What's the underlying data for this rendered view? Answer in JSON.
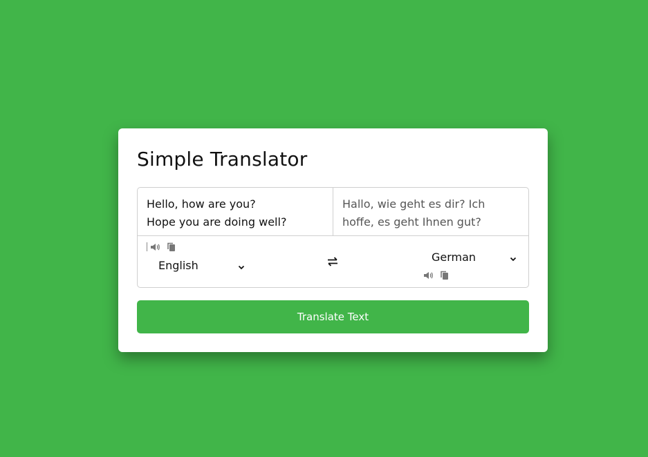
{
  "app": {
    "title": "Simple Translator"
  },
  "source": {
    "text": "Hello, how are you?\nHope you are doing well?",
    "language": "English"
  },
  "target": {
    "text": "Hallo, wie geht es dir? Ich hoffe, es geht Ihnen gut?",
    "language": "German"
  },
  "actions": {
    "translate_label": "Translate Text"
  },
  "colors": {
    "background": "#41b549",
    "button": "#41b549",
    "card": "#ffffff"
  },
  "icons": {
    "speak": "volume-icon",
    "copy": "copy-icon",
    "swap": "exchange-icon",
    "dropdown": "chevron-down-icon"
  }
}
